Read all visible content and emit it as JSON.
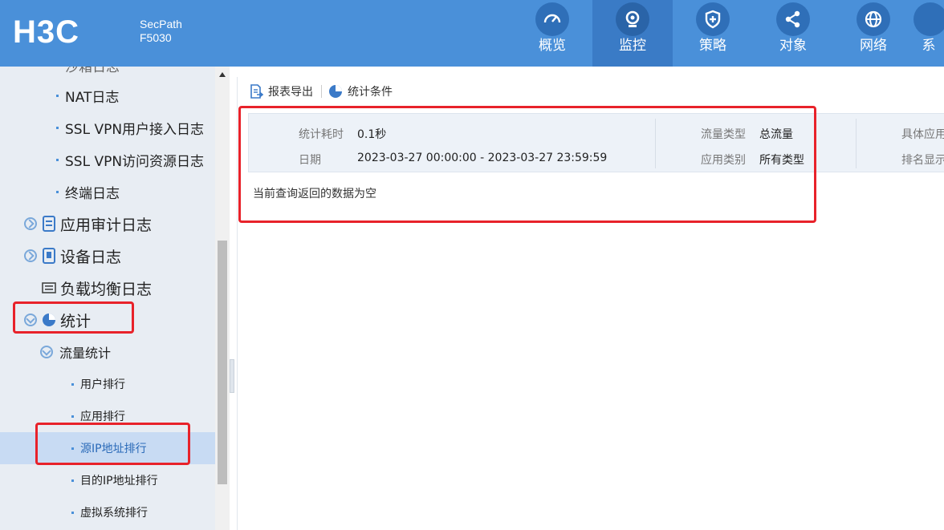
{
  "header": {
    "logo": "H3C",
    "product_line1": "SecPath",
    "product_line2": "F5030",
    "nav": [
      {
        "label": "概览",
        "icon": "dashboard-icon",
        "active": false
      },
      {
        "label": "监控",
        "icon": "webcam-icon",
        "active": true
      },
      {
        "label": "策略",
        "icon": "shield-icon",
        "active": false
      },
      {
        "label": "对象",
        "icon": "share-nodes-icon",
        "active": false
      },
      {
        "label": "网络",
        "icon": "globe-icon",
        "active": false
      },
      {
        "label": "系",
        "icon": "system-icon",
        "active": false
      }
    ]
  },
  "sidebar": {
    "items": [
      {
        "label": "沙箱日志",
        "level": 3
      },
      {
        "label": "NAT日志",
        "level": 3
      },
      {
        "label": "SSL VPN用户接入日志",
        "level": 3
      },
      {
        "label": "SSL VPN访问资源日志",
        "level": 3
      },
      {
        "label": "终端日志",
        "level": 3
      },
      {
        "label": "应用审计日志",
        "level": 1
      },
      {
        "label": "设备日志",
        "level": 1
      },
      {
        "label": "负载均衡日志",
        "level": 1
      },
      {
        "label": "统计",
        "level": 1
      },
      {
        "label": "流量统计",
        "level": 2
      },
      {
        "label": "用户排行",
        "level": 4
      },
      {
        "label": "应用排行",
        "level": 4
      },
      {
        "label": "源IP地址排行",
        "level": 4,
        "selected": true
      },
      {
        "label": "目的IP地址排行",
        "level": 4
      },
      {
        "label": "虚拟系统排行",
        "level": 4
      }
    ]
  },
  "toolbar": {
    "export_label": "报表导出",
    "conditions_label": "统计条件"
  },
  "summary": {
    "time_label": "统计耗时",
    "time_value": "0.1秒",
    "date_label": "日期",
    "date_value": "2023-03-27 00:00:00 - 2023-03-27 23:59:59",
    "traffic_type_label": "流量类型",
    "traffic_type_value": "总流量",
    "app_category_label": "应用类别",
    "app_category_value": "所有类型",
    "specific_app_label": "具体应用",
    "rank_display_label": "排名显示"
  },
  "empty_message": "当前查询返回的数据为空",
  "colors": {
    "header_bg": "#4a90d9",
    "highlight": "#e8222a",
    "sidebar_bg": "#e8edf3",
    "selected_bg": "#c8dbf3"
  }
}
